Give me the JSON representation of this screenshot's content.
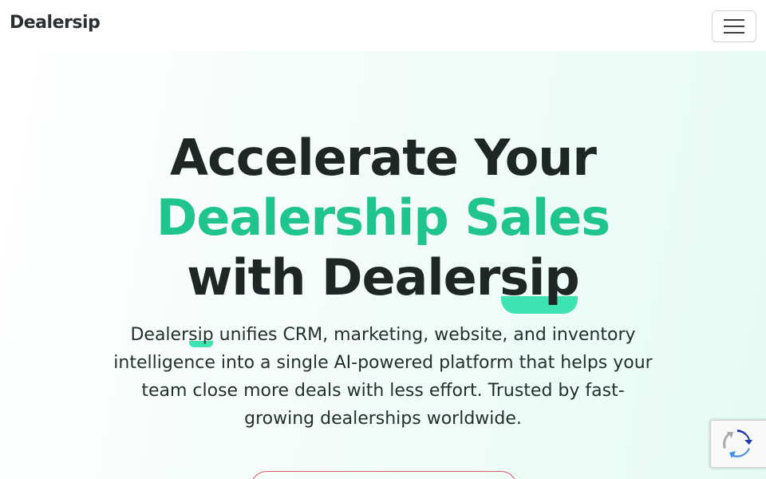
{
  "nav": {
    "brand_prefix": "Dealer",
    "brand_suffix": "sip",
    "menu_toggle_label": "Toggle navigation"
  },
  "hero": {
    "headline_line1": "Accelerate Your",
    "headline_line2": "Dealership Sales",
    "headline_line3_prefix": "with Dealer",
    "headline_line3_suffix": "sip",
    "description_prefix": "Dealer",
    "description_sip": "sip",
    "description_rest": " unifies CRM, marketing, website, and inventory intelligence into a single AI-powered platform that helps your team close more deals with less effort. Trusted by fast-growing dealerships worldwide."
  },
  "colors": {
    "accent_green": "#20c48e",
    "highlight_mint": "#3fe3b1",
    "cta_border": "#e0566a",
    "text_dark": "#1f2726"
  },
  "icons": {
    "menu": "hamburger-icon",
    "recaptcha": "recaptcha-icon"
  }
}
